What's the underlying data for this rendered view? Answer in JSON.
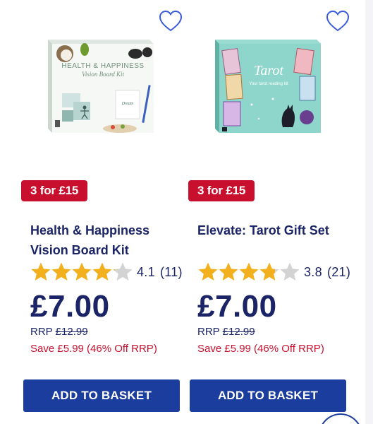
{
  "products": [
    {
      "promo": "3 for £15",
      "title": "Health & Happiness Vision Board Kit",
      "rating_value": 4.1,
      "rating_text": "4.1",
      "review_count": "(11)",
      "price": "£7.00",
      "rrp_label": "RRP",
      "rrp_price": "£12.99",
      "save_text": "Save £5.99 (46% Off RRP)",
      "button_label": "ADD TO BASKET",
      "box_title": "HEALTH & HAPPINESS",
      "box_subtitle": "Vision Board Kit"
    },
    {
      "promo": "3 for £15",
      "title": "Elevate: Tarot Gift Set",
      "rating_value": 3.8,
      "rating_text": "3.8",
      "review_count": "(21)",
      "price": "£7.00",
      "rrp_label": "RRP",
      "rrp_price": "£12.99",
      "save_text": "Save £5.99 (46% Off RRP)",
      "button_label": "ADD TO BASKET",
      "box_title": "Tarot",
      "box_subtitle": "Your tarot reading kit"
    }
  ],
  "colors": {
    "brand_navy": "#1b2466",
    "button_blue": "#1b3d9e",
    "promo_red": "#c8102e",
    "star_filled": "#f2b01e",
    "star_empty": "#d3d3d3",
    "heart_outline": "#3a5bd9"
  },
  "icons": {
    "wishlist": "heart-outline-icon",
    "rating": "star-icon"
  }
}
